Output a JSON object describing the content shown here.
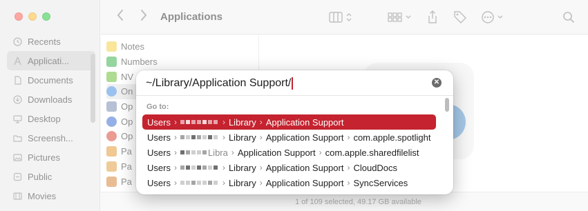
{
  "window": {
    "title": "Applications"
  },
  "sidebar": {
    "items": [
      {
        "label": "Recents",
        "icon": "clock-icon"
      },
      {
        "label": "Applicati...",
        "icon": "applications-icon",
        "active": true
      },
      {
        "label": "Documents",
        "icon": "document-icon"
      },
      {
        "label": "Downloads",
        "icon": "download-icon"
      },
      {
        "label": "Desktop",
        "icon": "desktop-icon"
      },
      {
        "label": "Screensh...",
        "icon": "folder-icon"
      },
      {
        "label": "Pictures",
        "icon": "pictures-icon"
      },
      {
        "label": "Public",
        "icon": "public-icon"
      },
      {
        "label": "Movies",
        "icon": "movies-icon"
      }
    ]
  },
  "file_list": {
    "rows": [
      {
        "label": "Notes",
        "color": "#f5d24a"
      },
      {
        "label": "Numbers",
        "color": "#3fb34f"
      },
      {
        "label": "NV",
        "color": "#6cbf3a"
      },
      {
        "label": "On",
        "color": "#4a90e2"
      },
      {
        "label": "Op",
        "color": "#7a8fb5"
      },
      {
        "label": "Op",
        "color": "#3c6fd1"
      },
      {
        "label": "Op",
        "color": "#d94b3b"
      },
      {
        "label": "Pa",
        "color": "#e39b3a"
      },
      {
        "label": "Pa",
        "color": "#e0a144"
      },
      {
        "label": "Pa",
        "color": "#d9853b"
      }
    ]
  },
  "statusbar": {
    "text": "1 of 109 selected, 49.17 GB available"
  },
  "dialog": {
    "path_value": "~/Library/Application Support/",
    "goto_label": "Go to:",
    "suggestions": [
      {
        "segments": [
          "Users",
          "",
          "Library",
          "Application Support"
        ],
        "selected": true
      },
      {
        "segments": [
          "Users",
          "",
          "Library",
          "Application Support",
          "com.apple.spotlight"
        ],
        "selected": false
      },
      {
        "segments": [
          "Users",
          "",
          "Libra",
          "Application Support",
          "com.apple.sharedfilelist"
        ],
        "selected": false
      },
      {
        "segments": [
          "Users",
          "",
          "Library",
          "Application Support",
          "CloudDocs"
        ],
        "selected": false
      },
      {
        "segments": [
          "Users",
          "",
          "Library",
          "Application Support",
          "SyncServices"
        ],
        "selected": false
      }
    ]
  },
  "colors": {
    "accent": "#c4232f",
    "preview": "#5b9bd5"
  }
}
